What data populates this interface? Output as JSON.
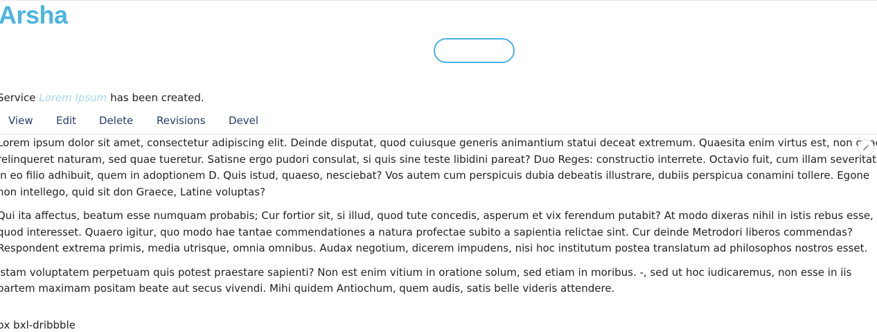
{
  "site": {
    "logo_text": "Arsha"
  },
  "status_message": {
    "prefix": "Service ",
    "title": "Lorem Ipsum",
    "suffix": " has been created."
  },
  "tabs": [
    {
      "label": "View"
    },
    {
      "label": "Edit"
    },
    {
      "label": "Delete"
    },
    {
      "label": "Revisions"
    },
    {
      "label": "Devel"
    }
  ],
  "content": {
    "paragraphs": [
      {
        "lines": [
          "Lorem ipsum dolor sit amet, consectetur adipiscing elit. Deinde disputat, quod cuiusque generis animantium statui deceat extremum. Quaesita enim virtus est, non quae",
          "relinqueret naturam, sed quae tueretur. Satisne ergo pudori consulat, si quis sine teste libidini pareat? Duo Reges: constructio interrete. Octavio fuit, cum illam severitatem",
          "in eo filio adhibuit, quem in adoptionem D. Quis istud, quaeso, nesciebat? Vos autem cum perspicuis dubia debeatis illustrare, dubiis perspicua conamini tollere. Egone",
          "non intellego, quid sit don Graece, Latine voluptas?"
        ]
      },
      {
        "lines": [
          "Qui ita affectus, beatum esse numquam probabis; Cur fortior sit, si illud, quod tute concedis, asperum et vix ferendum putabit? At modo dixeras nihil in istis rebus esse,",
          "quod interesset. Quaero igitur, quo modo hae tantae commendationes a natura profectae subito a sapientia relictae sint. Cur deinde Metrodori liberos commendas?",
          "Respondent extrema primis, media utrisque, omnia omnibus. Audax negotium, dicerem impudens, nisi hoc institutum postea translatum ad philosophos nostros esset."
        ]
      },
      {
        "lines": [
          "Istam voluptatem perpetuam quis potest praestare sapienti? Non est enim vitium in oratione solum, sed etiam in moribus. -, sed ut hoc iudicaremus, non esse in iis",
          "partem maximam positam beate aut secus vivendi. Mihi quidem Antiochum, quem audis, satis belle videris attendere."
        ]
      }
    ],
    "icon_class_text": "bx bxl-dribbble"
  },
  "icons": {
    "edit": "pencil-icon"
  },
  "colors": {
    "brand": "#47b2e4",
    "tab_link": "#2a3a6b",
    "italic_title": "#a7d7ee"
  }
}
